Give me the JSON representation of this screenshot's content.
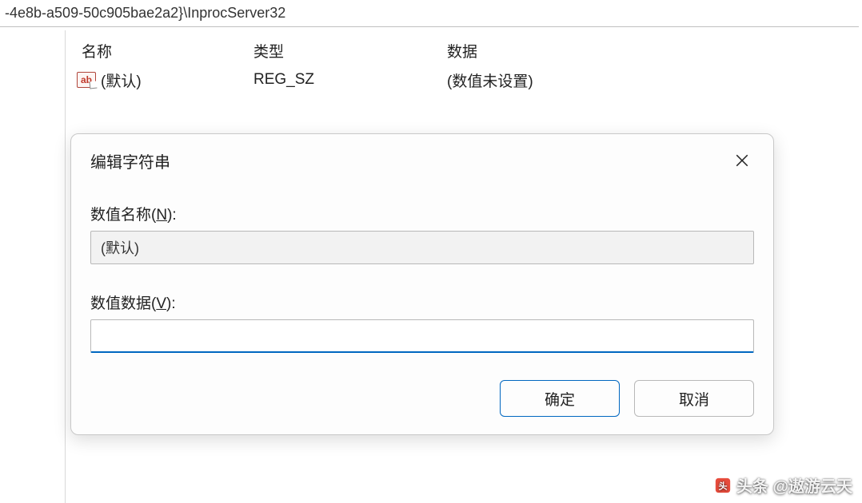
{
  "addressBar": {
    "path": "-4e8b-a509-50c905bae2a2}\\InprocServer32"
  },
  "registryTable": {
    "headers": {
      "name": "名称",
      "type": "类型",
      "data": "数据"
    },
    "row": {
      "name": "(默认)",
      "type": "REG_SZ",
      "data": "(数值未设置)"
    }
  },
  "dialog": {
    "title": "编辑字符串",
    "nameLabelPrefix": "数值名称(",
    "nameMnemonic": "N",
    "nameLabelSuffix": "):",
    "nameValue": "(默认)",
    "dataLabelPrefix": "数值数据(",
    "dataMnemonic": "V",
    "dataLabelSuffix": "):",
    "dataValue": "",
    "okButton": "确定",
    "cancelButton": "取消"
  },
  "watermark": {
    "text": "头条 @遨游云天"
  }
}
